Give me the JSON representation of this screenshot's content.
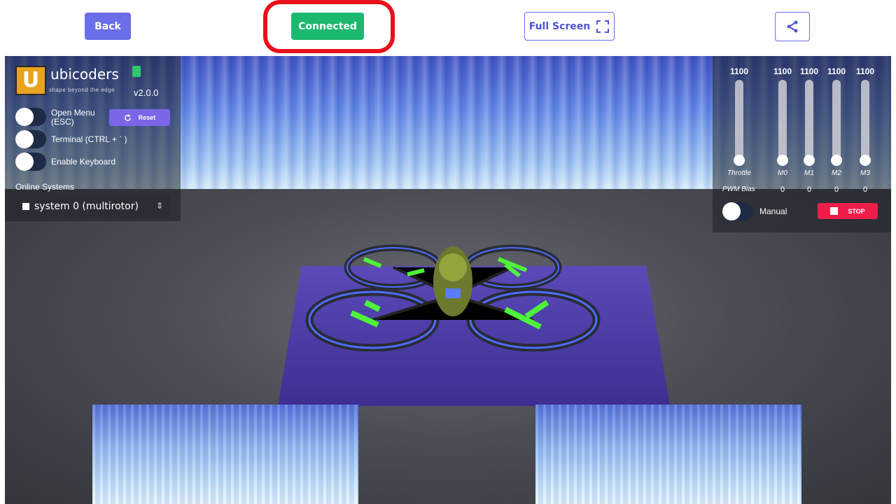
{
  "topbar": {
    "back_label": "Back",
    "connected_label": "Connected",
    "fullscreen_label": "Full Screen",
    "colors": {
      "primary": "#6a6ee9",
      "connected": "#1db86f",
      "highlight": "#e8101c"
    }
  },
  "icons": {
    "fullscreen": "fullscreen-icon",
    "share": "share-icon",
    "reset": "refresh-icon",
    "stop": "stop-icon",
    "select": "chevron-updown-icon"
  },
  "left_panel": {
    "brand": "ubicoders",
    "tagline": "shape beyond the edge",
    "version": "v2.0.0",
    "toggles": [
      {
        "label": "Open Menu (ESC)"
      },
      {
        "label": "Terminal (CTRL + ` )"
      },
      {
        "label": "Enable Keyboard"
      }
    ],
    "reset_label": "Reset",
    "online_systems_label": "Online Systems",
    "selected_system": "system 0 (multirotor)"
  },
  "right_panel": {
    "sliders": [
      {
        "label": "Throttle",
        "value": "1100",
        "bias": ""
      },
      {
        "label": "M0",
        "value": "1100",
        "bias": "0"
      },
      {
        "label": "M1",
        "value": "1100",
        "bias": "0"
      },
      {
        "label": "M2",
        "value": "1100",
        "bias": "0"
      },
      {
        "label": "M3",
        "value": "1100",
        "bias": "0"
      }
    ],
    "pwm_bias_label": "PWM Bias",
    "manual_label": "Manual",
    "stop_label": "STOP"
  }
}
